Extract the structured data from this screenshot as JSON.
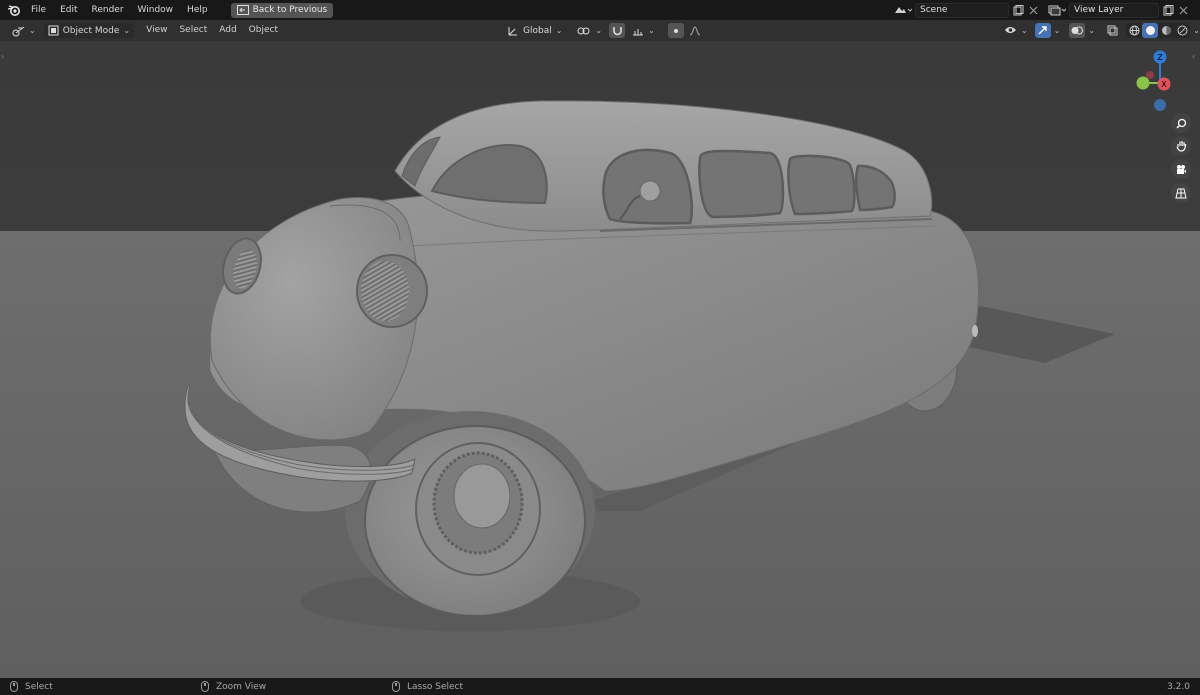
{
  "topbar": {
    "menus": [
      "File",
      "Edit",
      "Render",
      "Window",
      "Help"
    ],
    "back_button": "Back to Previous",
    "scene": "Scene",
    "view_layer": "View Layer"
  },
  "viewport_header": {
    "mode": "Object Mode",
    "menus": [
      "View",
      "Select",
      "Add",
      "Object"
    ],
    "transform_orientation": "Global"
  },
  "navigation_gizmo": {
    "z_axis": "Z",
    "x_axis": "X"
  },
  "statusbar": {
    "left_hint": "Select",
    "middle_hint": "Zoom View",
    "right_hint": "Lasso Select",
    "version": "3.2.0"
  },
  "colors": {
    "accent": "#4772b3",
    "x_axis": "#e0525c",
    "y_axis": "#8bc34a",
    "z_axis": "#2f7bd8"
  }
}
